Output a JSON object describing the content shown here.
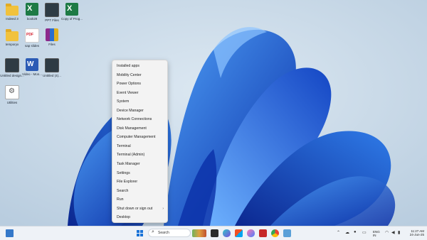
{
  "desktop_icons": [
    {
      "label": "Indeed 3",
      "type": "folder"
    },
    {
      "label": "book29",
      "type": "excel"
    },
    {
      "label": "PPT Files",
      "type": "video"
    },
    {
      "label": "Copy of Prog...",
      "type": "excel"
    },
    {
      "label": "temporyx",
      "type": "folder"
    },
    {
      "label": "sap slides",
      "type": "pdf"
    },
    {
      "label": "Files",
      "type": "rar"
    },
    {
      "label": "Untitled design...",
      "type": "video"
    },
    {
      "label": "Video - Mon...",
      "type": "word"
    },
    {
      "label": "Untitled (4)...",
      "type": "video"
    },
    {
      "label": "Utilities",
      "type": "app"
    }
  ],
  "context_menu": {
    "items": [
      "Installed apps",
      "Mobility Center",
      "Power Options",
      "Event Viewer",
      "System",
      "Device Manager",
      "Network Connections",
      "Disk Management",
      "Computer Management",
      "Terminal",
      "Terminal (Admin)",
      "Task Manager",
      "Settings",
      "File Explorer",
      "Search",
      "Run",
      "Shut down or sign out",
      "Desktop"
    ],
    "submenu_chevron": "›"
  },
  "taskbar": {
    "search_placeholder": "Search",
    "language": "ENG",
    "region": "IN",
    "time": "11:27 AM",
    "date": "24-Jun-25"
  },
  "colors": {
    "wallpaper_bg": "#c9d9e6",
    "bloom_dark": "#0a2fa8",
    "bloom_light": "#3d8cf0",
    "accent": "#1a73d8"
  }
}
